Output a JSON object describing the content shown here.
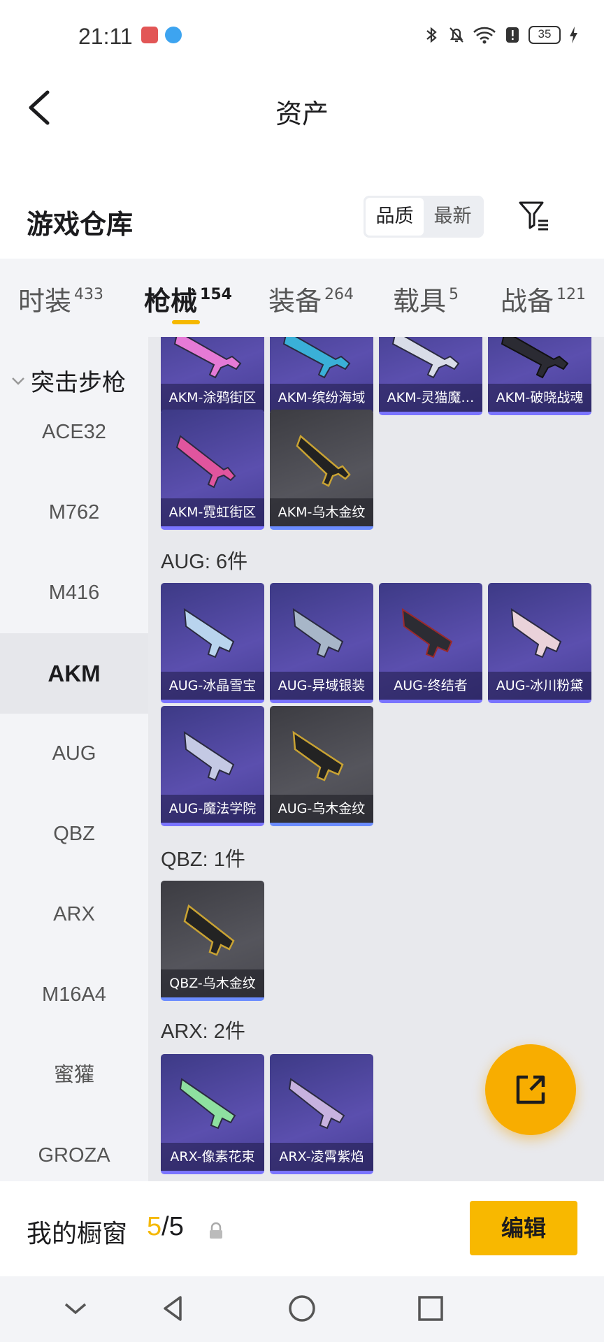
{
  "status_bar": {
    "time": "21:11",
    "battery": "35"
  },
  "header": {
    "title": "资产"
  },
  "warehouse": {
    "title": "游戏仓库",
    "sort_options": [
      "品质",
      "最新"
    ]
  },
  "tabs": [
    {
      "label": "时装",
      "count": "433"
    },
    {
      "label": "枪械",
      "count": "154"
    },
    {
      "label": "装备",
      "count": "264"
    },
    {
      "label": "载具",
      "count": "5"
    },
    {
      "label": "战备",
      "count": "121"
    }
  ],
  "sidebar": {
    "group": "突击步枪",
    "items": [
      "ACE32",
      "M762",
      "M416",
      "AKM",
      "AUG",
      "QBZ",
      "ARX",
      "M16A4",
      "蜜獾",
      "GROZA"
    ],
    "active": "AKM"
  },
  "sections": {
    "akm_items": [
      "AKM-涂鸦街区",
      "AKM-缤纷海域",
      "AKM-灵猫魔…",
      "AKM-破晓战魂",
      "AKM-霓虹街区",
      "AKM-乌木金纹"
    ],
    "aug_head": "AUG: 6件",
    "aug_items": [
      "AUG-冰晶雪宝",
      "AUG-异域银装",
      "AUG-终结者",
      "AUG-冰川粉黛",
      "AUG-魔法学院",
      "AUG-乌木金纹"
    ],
    "qbz_head": "QBZ: 1件",
    "qbz_items": [
      "QBZ-乌木金纹"
    ],
    "arx_head": "ARX: 2件",
    "arx_items": [
      "ARX-像素花束",
      "ARX-凌霄紫焰"
    ]
  },
  "showcase": {
    "label": "我的橱窗",
    "current": "5",
    "total": "/5",
    "edit_label": "编辑"
  },
  "colors": {
    "accent": "#f8b800",
    "purple_card": "#4f47a3",
    "gray_card": "#4b4b52"
  }
}
